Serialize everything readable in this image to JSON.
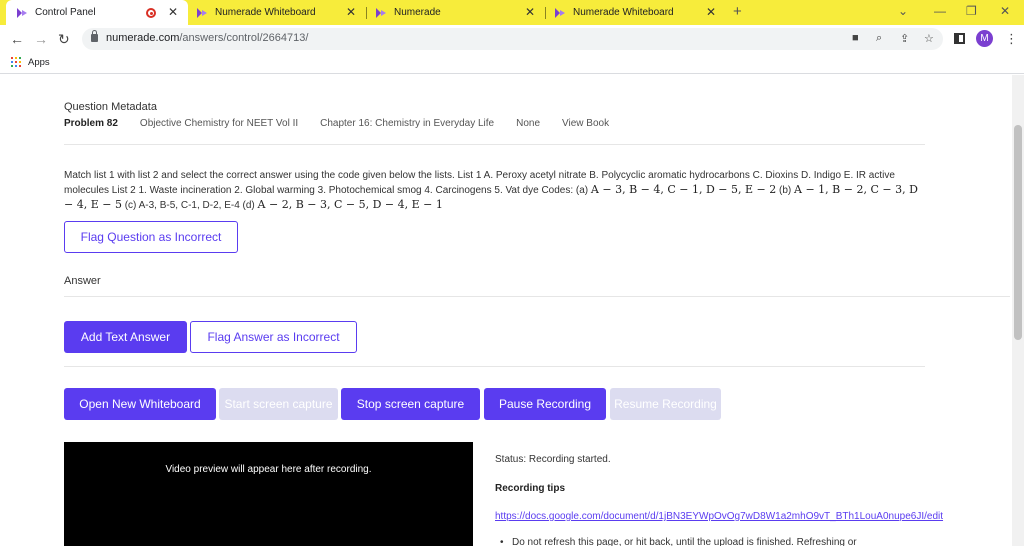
{
  "browser": {
    "tabs": [
      {
        "title": "Control Panel",
        "active": true,
        "recording": true
      },
      {
        "title": "Numerade Whiteboard",
        "active": false
      },
      {
        "title": "Numerade",
        "active": false
      },
      {
        "title": "Numerade Whiteboard",
        "active": false
      }
    ],
    "new_tab_symbol": "+",
    "url_host": "numerade.com",
    "url_path": "/answers/control/2664713/",
    "avatar_letter": "M",
    "bookmarks_apps": "Apps",
    "colors": {
      "tabbar": "#f7ec3b",
      "accent": "#5a3cf0",
      "avatar": "#7b3fd0"
    }
  },
  "metadata": {
    "title": "Question Metadata",
    "problem": "Problem 82",
    "book": "Objective Chemistry for NEET Vol II",
    "chapter": "Chapter 16: Chemistry in Everyday Life",
    "section": "None",
    "view_book": "View Book"
  },
  "question": {
    "text_1": "Match list 1 with list 2 and select the correct answer using the code given below the lists. List 1 A. Peroxy acetyl nitrate B. Polycyclic aromatic hydrocarbons C. Dioxins D. Indigo E. IR active molecules List 2 1. Waste incineration 2. Global warming 3. Photochemical smog 4. Carcinogens 5. Vat dye Codes: (a) ",
    "math_a": "A − 3,  B − 4, C − 1, D − 5, E − 2",
    "text_b": " (b) ",
    "math_b": "A − 1,  B − 2, C − 3, D − 4, E − 5",
    "text_c": " (c) A-3, B-5, C-1, D-2, E-4 (d) ",
    "math_d": "A − 2,  B − 3, C − 5, D − 4, E − 1"
  },
  "buttons": {
    "flag_question": "Flag Question as Incorrect",
    "add_text_answer": "Add Text Answer",
    "flag_answer": "Flag Answer as Incorrect",
    "open_whiteboard": "Open New Whiteboard",
    "start_capture": "Start screen capture",
    "stop_capture": "Stop screen capture",
    "pause_recording": "Pause Recording",
    "resume_recording": "Resume Recording"
  },
  "answer_label": "Answer",
  "video_preview": "Video preview will appear here after recording.",
  "status": "Status: Recording started.",
  "tips": {
    "title": "Recording tips",
    "link": "https://docs.google.com/document/d/1jBN3EYWpOvOg7wD8W1a2mhO9vT_BTh1LouA0nupe6JI/edit",
    "bullet": "Do not refresh this page, or hit back, until the upload is finished. Refreshing or"
  }
}
